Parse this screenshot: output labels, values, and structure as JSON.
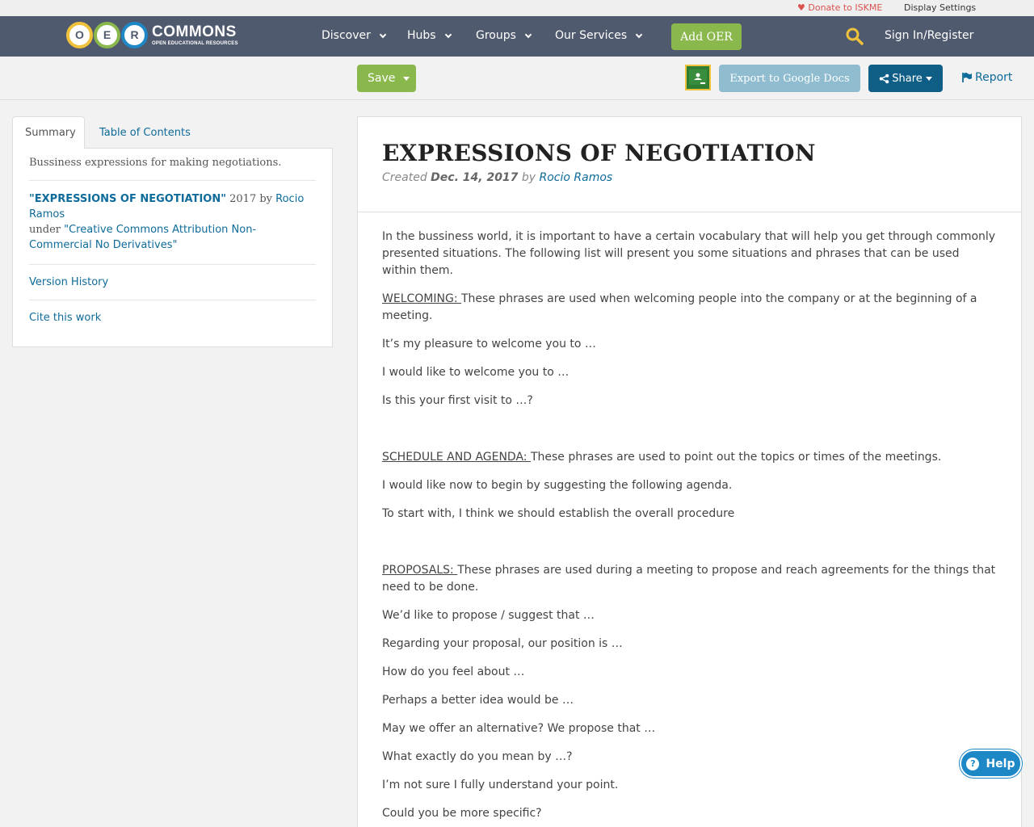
{
  "utility": {
    "donate": "Donate to ISKME",
    "display_settings": "Display Settings"
  },
  "logo": {
    "letters": [
      "O",
      "E",
      "R"
    ],
    "wordmark": "COMMONS",
    "tagline": "OPEN EDUCATIONAL RESOURCES"
  },
  "nav": {
    "items": [
      "Discover",
      "Hubs",
      "Groups",
      "Our Services"
    ],
    "add_oer": "Add OER",
    "sign_in": "Sign In/Register"
  },
  "actions": {
    "save": "Save",
    "export": "Export to Google Docs",
    "share": "Share",
    "report": "Report"
  },
  "sidebar": {
    "tabs": [
      "Summary",
      "Table of Contents"
    ],
    "description": "Bussiness expressions for making negotiations.",
    "attribution": {
      "title": "\"EXPRESSIONS OF NEGOTIATION\"",
      "year": " 2017 by ",
      "author": "Rocio Ramos",
      "under": "under ",
      "license": "\"Creative Commons Attribution Non-Commercial No Derivatives\""
    },
    "version_history": "Version History",
    "cite": "Cite this work"
  },
  "doc": {
    "title": "EXPRESSIONS OF NEGOTIATION",
    "created_label": "Created ",
    "created_date": "Dec. 14, 2017",
    "by": " by ",
    "author": "Rocio Ramos",
    "intro": "In the bussiness world, it is important to have a certain vocabulary that will help you get through commonly presented situations. The following list will present you some situations and phrases that can be used within them.",
    "welcoming_label": "WELCOMING: ",
    "welcoming_desc": "These phrases are used when welcoming people into the company or at the beginning of a meeting.",
    "welcoming_items": [
      "It’s my pleasure to welcome you to …",
      "I would like to welcome you to …",
      "Is this your first visit to …?"
    ],
    "schedule_label": "SCHEDULE AND AGENDA: ",
    "schedule_desc": "These phrases are used to point out the topics or times of the meetings.",
    "schedule_items": [
      "I would like now to begin by suggesting the following agenda.",
      "To start with, I think we should establish the overall procedure"
    ],
    "proposals_label": "PROPOSALS: ",
    "proposals_desc": "These phrases are used during a meeting to propose and reach agreements for the things that need to be done.",
    "proposals_items": [
      "We’d like to propose / suggest that …",
      "Regarding your proposal, our position is …",
      "How do you feel about …",
      "Perhaps a better idea would be …",
      "May we offer an alternative? We propose that …",
      "What exactly do you mean by …?",
      "I’m not sure I fully understand your point.",
      "Could you be more specific?"
    ]
  },
  "help": "Help"
}
